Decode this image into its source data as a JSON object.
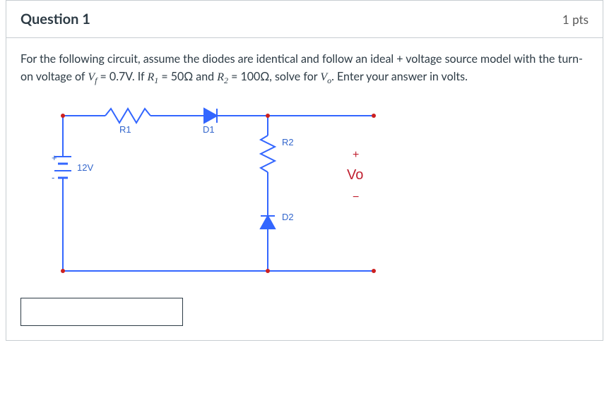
{
  "header": {
    "title": "Question 1",
    "points": "1 pts"
  },
  "stem": {
    "t1": "For the following circuit, assume the diodes are identical and follow an ideal + voltage source model with the turn-on voltage of ",
    "vf_sym": "V",
    "vf_sub": "f",
    "eq1": " = 0.7V",
    "t2": ". If ",
    "r1_sym": "R",
    "r1_sub": "1",
    "eq2": " = 50Ω and ",
    "r2_sym": "R",
    "r2_sub": "2",
    "eq3": " = 100Ω",
    "t3": ", solve for ",
    "vo_sym": "V",
    "vo_sub": "o",
    "t4": ". Enter your answer in volts."
  },
  "circuit": {
    "labels": {
      "source": "12V",
      "r1": "R1",
      "d1": "D1",
      "r2": "R2",
      "d2": "D2",
      "vo": "Vo",
      "plus": "+",
      "minus": "−"
    }
  },
  "answer": {
    "value": ""
  }
}
